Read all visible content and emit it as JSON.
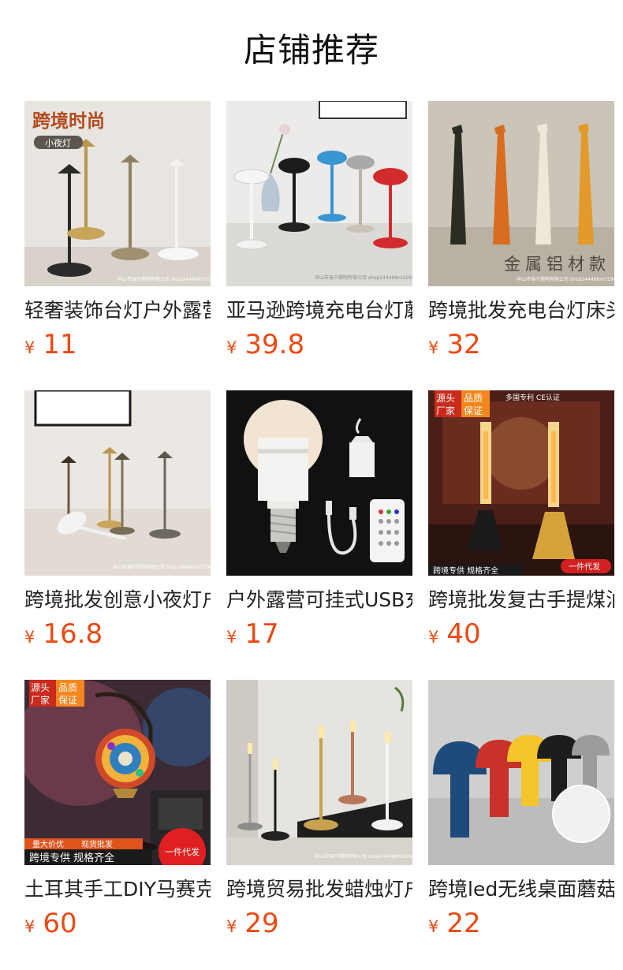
{
  "header": {
    "title": "店铺推荐"
  },
  "currency": "¥",
  "products": [
    {
      "name": "轻奢装饰台灯户外露营",
      "price": "11",
      "img_text": {
        "badge": "跨境时尚",
        "sub": "小夜灯",
        "wm": "中山市瑞千照明有限公司 shop244468m319465.1688.com"
      }
    },
    {
      "name": "亚马逊跨境充电台灯蘑",
      "price": "39.8",
      "img_text": {
        "wm": "中山市瑞千照明有限公司 shop244468m319465.1688.com"
      }
    },
    {
      "name": "跨境批发充电台灯床头",
      "price": "32",
      "img_text": {
        "caption": "金属铝材款",
        "wm": "中山市瑞千照明有限公司 shop244468m319465.1688.com"
      }
    },
    {
      "name": "跨境批发创意小夜灯户",
      "price": "16.8",
      "img_text": {
        "wm": "中山市瑞千照明有限公司 shop244468m319465.1688.com"
      }
    },
    {
      "name": "户外露营可挂式USB充",
      "price": "17",
      "img_text": {}
    },
    {
      "name": "跨境批发复古手提煤油",
      "price": "40",
      "img_text": {
        "badge1": "源头厂家",
        "badge2": "品质保证",
        "top": "多国专利  CE认证",
        "bottom": "跨境专供 规格齐全",
        "tag": "一件代发"
      }
    },
    {
      "name": "土耳其手工DIY马赛克",
      "price": "60",
      "img_text": {
        "badge1": "源头厂家",
        "badge2": "品质保证",
        "strip1": "量大价优",
        "strip2": "现货批发",
        "bottom": "跨境专供 规格齐全",
        "tag": "一件代发"
      }
    },
    {
      "name": "跨境贸易批发蜡烛灯户",
      "price": "29",
      "img_text": {
        "wm": "中山市瑞千照明有限公司 shop244468m319465.1688.com"
      }
    },
    {
      "name": "跨境led无线桌面蘑菇",
      "price": "22",
      "img_text": {}
    }
  ]
}
